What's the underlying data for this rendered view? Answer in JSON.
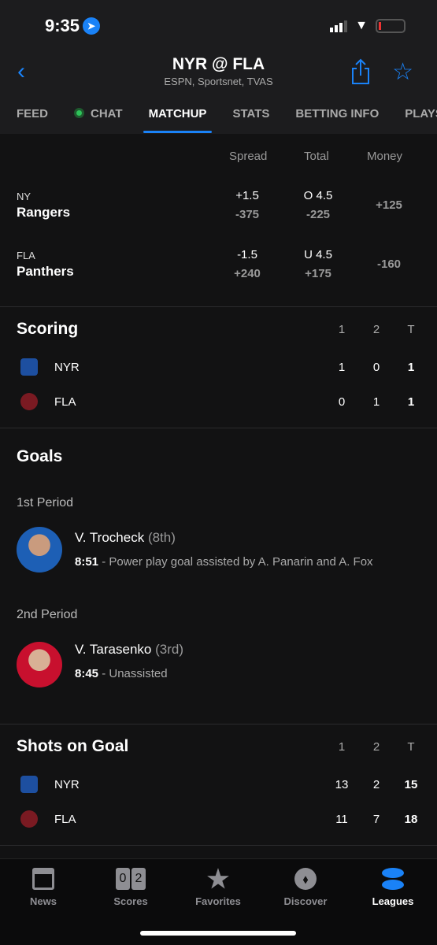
{
  "status": {
    "time": "9:35"
  },
  "header": {
    "title": "NYR @ FLA",
    "subtitle": "ESPN, Sportsnet, TVAS"
  },
  "tabs": [
    "FEED",
    "CHAT",
    "MATCHUP",
    "STATS",
    "BETTING INFO",
    "PLAYS"
  ],
  "odds": {
    "headers": [
      "Spread",
      "Total",
      "Money"
    ],
    "teams": [
      {
        "city": "NY",
        "name": "Rangers",
        "spread": "+1.5",
        "spread_odds": "-375",
        "total": "O 4.5",
        "total_odds": "-225",
        "money": "+125"
      },
      {
        "city": "FLA",
        "name": "Panthers",
        "spread": "-1.5",
        "spread_odds": "+240",
        "total": "U 4.5",
        "total_odds": "+175",
        "money": "-160"
      }
    ]
  },
  "scoring": {
    "title": "Scoring",
    "cols": [
      "1",
      "2",
      "T"
    ],
    "rows": [
      {
        "team": "NYR",
        "vals": [
          "1",
          "0",
          "1"
        ]
      },
      {
        "team": "FLA",
        "vals": [
          "0",
          "1",
          "1"
        ]
      }
    ]
  },
  "goals": {
    "title": "Goals",
    "periods": [
      {
        "label": "1st Period",
        "player": "V. Trocheck",
        "count": "(8th)",
        "time": "8:51",
        "desc": " - Power play goal assisted by A. Panarin and A. Fox"
      },
      {
        "label": "2nd Period",
        "player": "V. Tarasenko",
        "count": "(3rd)",
        "time": "8:45",
        "desc": " - Unassisted"
      }
    ]
  },
  "shots": {
    "title": "Shots on Goal",
    "cols": [
      "1",
      "2",
      "T"
    ],
    "rows": [
      {
        "team": "NYR",
        "vals": [
          "13",
          "2",
          "15"
        ]
      },
      {
        "team": "FLA",
        "vals": [
          "11",
          "7",
          "18"
        ]
      }
    ]
  },
  "nav": {
    "items": [
      "News",
      "Scores",
      "Favorites",
      "Discover",
      "Leagues"
    ],
    "scores_digits": [
      "0",
      "2"
    ],
    "active": "Leagues"
  },
  "colors": {
    "accent": "#1a82f7",
    "nyr": "#1d4fa0",
    "fla": "#c8102e"
  }
}
